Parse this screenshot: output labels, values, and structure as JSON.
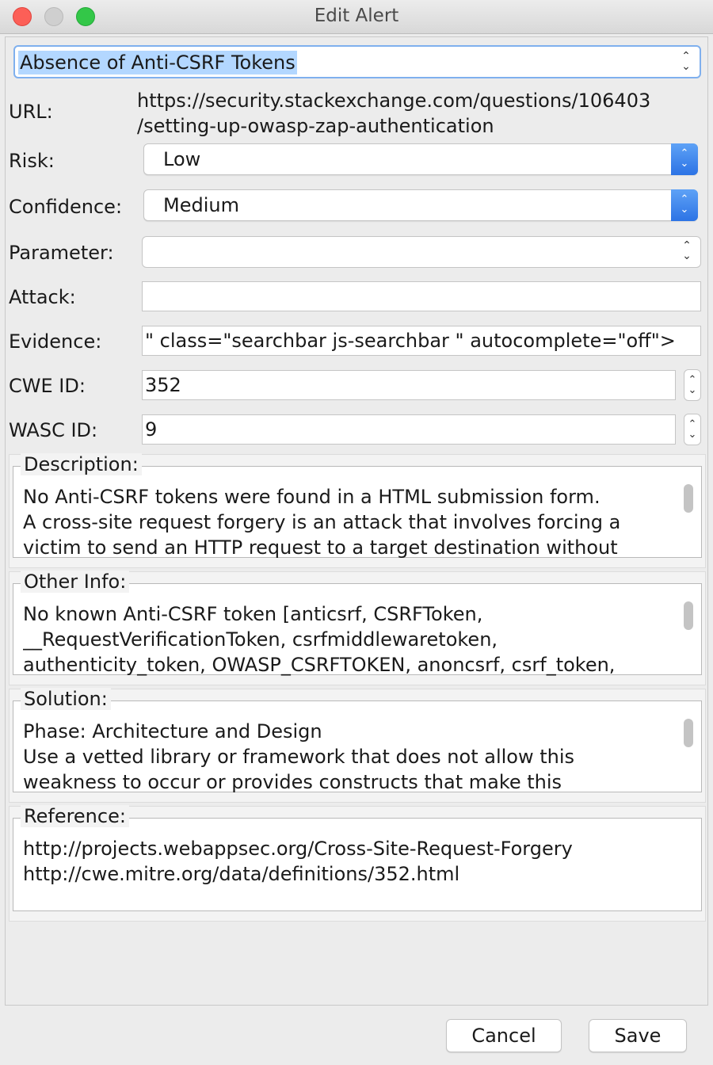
{
  "window": {
    "title": "Edit Alert"
  },
  "alert_name": {
    "value": "Absence of Anti-CSRF Tokens"
  },
  "url": {
    "label": "URL:",
    "line1": "https://security.stackexchange.com/questions/106403",
    "line2": "/setting-up-owasp-zap-authentication"
  },
  "risk": {
    "label": "Risk:",
    "value": "Low"
  },
  "confidence": {
    "label": "Confidence:",
    "value": "Medium"
  },
  "parameter": {
    "label": "Parameter:",
    "value": ""
  },
  "attack": {
    "label": "Attack:",
    "value": ""
  },
  "evidence": {
    "label": "Evidence:",
    "value": "\" class=\"searchbar js-searchbar \" autocomplete=\"off\">"
  },
  "cwe_id": {
    "label": "CWE ID:",
    "value": "352"
  },
  "wasc_id": {
    "label": "WASC ID:",
    "value": "9"
  },
  "description": {
    "title": "Description:",
    "text": "No Anti-CSRF tokens were found in a HTML submission form.\nA cross-site request forgery is an attack that involves forcing a\nvictim to send an HTTP request to a target destination without"
  },
  "other_info": {
    "title": "Other Info:",
    "text": "No known Anti-CSRF token [anticsrf, CSRFToken,\n__RequestVerificationToken, csrfmiddlewaretoken,\nauthenticity_token, OWASP_CSRFTOKEN, anoncsrf, csrf_token,"
  },
  "solution": {
    "title": "Solution:",
    "text": "Phase: Architecture and Design\nUse a vetted library or framework that does not allow this\nweakness to occur or provides constructs that make this"
  },
  "reference": {
    "title": "Reference:",
    "text": "http://projects.webappsec.org/Cross-Site-Request-Forgery\nhttp://cwe.mitre.org/data/definitions/352.html"
  },
  "buttons": {
    "cancel": "Cancel",
    "save": "Save"
  },
  "colors": {
    "accent": "#2c73e5",
    "selection": "#b3d7ff",
    "close": "#fc5f57",
    "maximize": "#33c748"
  }
}
